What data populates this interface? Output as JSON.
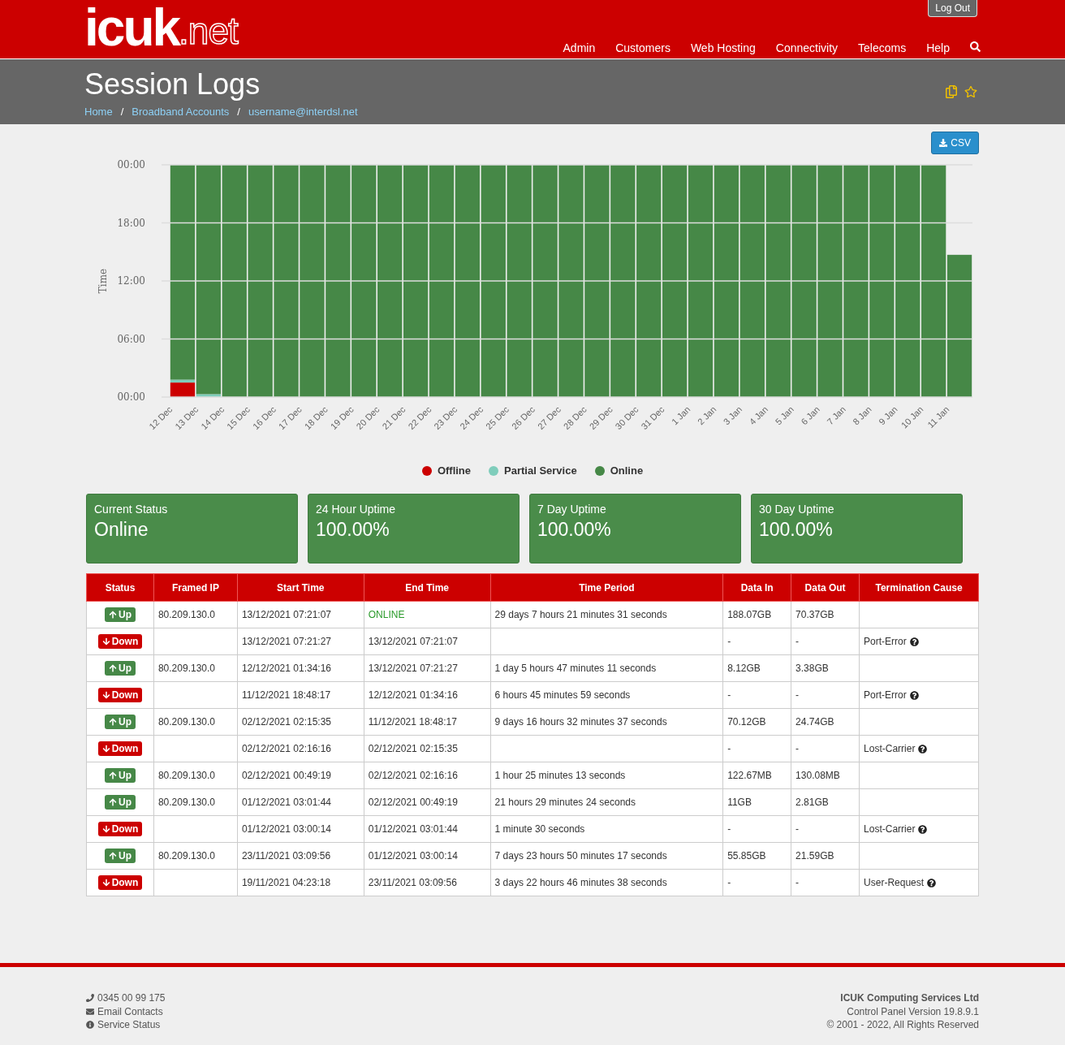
{
  "header": {
    "logo": {
      "main": "icuk",
      "suffix": ".net"
    },
    "logout": "Log Out",
    "nav": [
      "Admin",
      "Customers",
      "Web Hosting",
      "Connectivity",
      "Telecoms",
      "Help"
    ]
  },
  "page": {
    "title": "Session Logs",
    "breadcrumbs": [
      "Home",
      "Broadband Accounts",
      "username@interdsl.net"
    ],
    "separator": "/"
  },
  "csv_button": "CSV",
  "chart_data": {
    "type": "bar",
    "stacked": true,
    "ylabel": "Time",
    "ylim": [
      0,
      24
    ],
    "yticks": [
      {
        "value": 0,
        "label": "00:00"
      },
      {
        "value": 6,
        "label": "06:00"
      },
      {
        "value": 12,
        "label": "12:00"
      },
      {
        "value": 18,
        "label": "18:00"
      },
      {
        "value": 24,
        "label": "00:00"
      }
    ],
    "categories": [
      "12 Dec",
      "13 Dec",
      "14 Dec",
      "15 Dec",
      "16 Dec",
      "17 Dec",
      "18 Dec",
      "19 Dec",
      "20 Dec",
      "21 Dec",
      "22 Dec",
      "23 Dec",
      "24 Dec",
      "25 Dec",
      "26 Dec",
      "27 Dec",
      "28 Dec",
      "29 Dec",
      "30 Dec",
      "31 Dec",
      "1 Jan",
      "2 Jan",
      "3 Jan",
      "4 Jan",
      "5 Jan",
      "6 Jan",
      "7 Jan",
      "8 Jan",
      "9 Jan",
      "10 Jan",
      "11 Jan"
    ],
    "grid": true,
    "series": [
      {
        "name": "Offline",
        "color": "#cc0000",
        "values": [
          1.5,
          0,
          0,
          0,
          0,
          0,
          0,
          0,
          0,
          0,
          0,
          0,
          0,
          0,
          0,
          0,
          0,
          0,
          0,
          0,
          0,
          0,
          0,
          0,
          0,
          0,
          0,
          0,
          0,
          0,
          0
        ]
      },
      {
        "name": "Partial Service",
        "color": "#7fcdbb",
        "values": [
          0.3,
          0.3,
          0,
          0,
          0,
          0,
          0,
          0,
          0,
          0,
          0,
          0,
          0,
          0,
          0,
          0,
          0,
          0,
          0,
          0,
          0,
          0,
          0,
          0,
          0,
          0,
          0,
          0,
          0,
          0,
          0
        ]
      },
      {
        "name": "Online",
        "color": "#468847",
        "values": [
          22.2,
          23.7,
          24,
          24,
          24,
          24,
          24,
          24,
          24,
          24,
          24,
          24,
          24,
          24,
          24,
          24,
          24,
          24,
          24,
          24,
          24,
          24,
          24,
          24,
          24,
          24,
          24,
          24,
          24,
          24,
          14.7
        ]
      }
    ]
  },
  "stats": [
    {
      "label": "Current Status",
      "value": "Online"
    },
    {
      "label": "24 Hour Uptime",
      "value": "100.00%"
    },
    {
      "label": "7 Day Uptime",
      "value": "100.00%"
    },
    {
      "label": "30 Day Uptime",
      "value": "100.00%"
    }
  ],
  "table": {
    "columns": [
      "Status",
      "Framed IP",
      "Start Time",
      "End Time",
      "Time Period",
      "Data In",
      "Data Out",
      "Termination Cause"
    ],
    "rows": [
      {
        "status": {
          "kind": "up",
          "label": "Up"
        },
        "ip": "80.209.130.0",
        "start": "13/12/2021 07:21:07",
        "end": "ONLINE",
        "live": true,
        "period": "29 days 7 hours 21 minutes 31 seconds",
        "data_in": "188.07GB",
        "data_out": "70.37GB"
      },
      {
        "status": {
          "kind": "down",
          "label": "Down"
        },
        "start": "13/12/2021 07:21:27",
        "end": "13/12/2021 07:21:07",
        "live": false,
        "data_in": "-",
        "data_out": "-",
        "cause": "Port-Error"
      },
      {
        "status": {
          "kind": "up",
          "label": "Up"
        },
        "ip": "80.209.130.0",
        "start": "12/12/2021 01:34:16",
        "end": "13/12/2021 07:21:27",
        "live": false,
        "period": "1 day 5 hours 47 minutes 11 seconds",
        "data_in": "8.12GB",
        "data_out": "3.38GB"
      },
      {
        "status": {
          "kind": "down",
          "label": "Down"
        },
        "start": "11/12/2021 18:48:17",
        "end": "12/12/2021 01:34:16",
        "live": false,
        "period": "6 hours 45 minutes 59 seconds",
        "data_in": "-",
        "data_out": "-",
        "cause": "Port-Error"
      },
      {
        "status": {
          "kind": "up",
          "label": "Up"
        },
        "ip": "80.209.130.0",
        "start": "02/12/2021 02:15:35",
        "end": "11/12/2021 18:48:17",
        "live": false,
        "period": "9 days 16 hours 32 minutes 37 seconds",
        "data_in": "70.12GB",
        "data_out": "24.74GB"
      },
      {
        "status": {
          "kind": "down",
          "label": "Down"
        },
        "start": "02/12/2021 02:16:16",
        "end": "02/12/2021 02:15:35",
        "live": false,
        "data_in": "-",
        "data_out": "-",
        "cause": "Lost-Carrier"
      },
      {
        "status": {
          "kind": "up",
          "label": "Up"
        },
        "ip": "80.209.130.0",
        "start": "02/12/2021 00:49:19",
        "end": "02/12/2021 02:16:16",
        "live": false,
        "period": "1 hour 25 minutes 13 seconds",
        "data_in": "122.67MB",
        "data_out": "130.08MB"
      },
      {
        "status": {
          "kind": "up",
          "label": "Up"
        },
        "ip": "80.209.130.0",
        "start": "01/12/2021 03:01:44",
        "end": "02/12/2021 00:49:19",
        "live": false,
        "period": "21 hours 29 minutes 24 seconds",
        "data_in": "11GB",
        "data_out": "2.81GB"
      },
      {
        "status": {
          "kind": "down",
          "label": "Down"
        },
        "start": "01/12/2021 03:00:14",
        "end": "01/12/2021 03:01:44",
        "live": false,
        "period": "1 minute 30 seconds",
        "data_in": "-",
        "data_out": "-",
        "cause": "Lost-Carrier"
      },
      {
        "status": {
          "kind": "up",
          "label": "Up"
        },
        "ip": "80.209.130.0",
        "start": "23/11/2021 03:09:56",
        "end": "01/12/2021 03:00:14",
        "live": false,
        "period": "7 days 23 hours 50 minutes 17 seconds",
        "data_in": "55.85GB",
        "data_out": "21.59GB"
      },
      {
        "status": {
          "kind": "down",
          "label": "Down"
        },
        "start": "19/11/2021 04:23:18",
        "end": "23/11/2021 03:09:56",
        "live": false,
        "period": "3 days 22 hours 46 minutes 38 seconds",
        "data_in": "-",
        "data_out": "-",
        "cause": "User-Request"
      }
    ]
  },
  "footer": {
    "contacts": [
      {
        "kind": "phone",
        "text": "0345 00 99 175"
      },
      {
        "kind": "email",
        "text": "Email Contacts"
      },
      {
        "kind": "info",
        "text": "Service Status"
      }
    ],
    "company": "ICUK Computing Services Ltd",
    "version": "Control Panel Version 19.8.9.1",
    "copyright": "© 2001 - 2022, All Rights Reserved"
  }
}
